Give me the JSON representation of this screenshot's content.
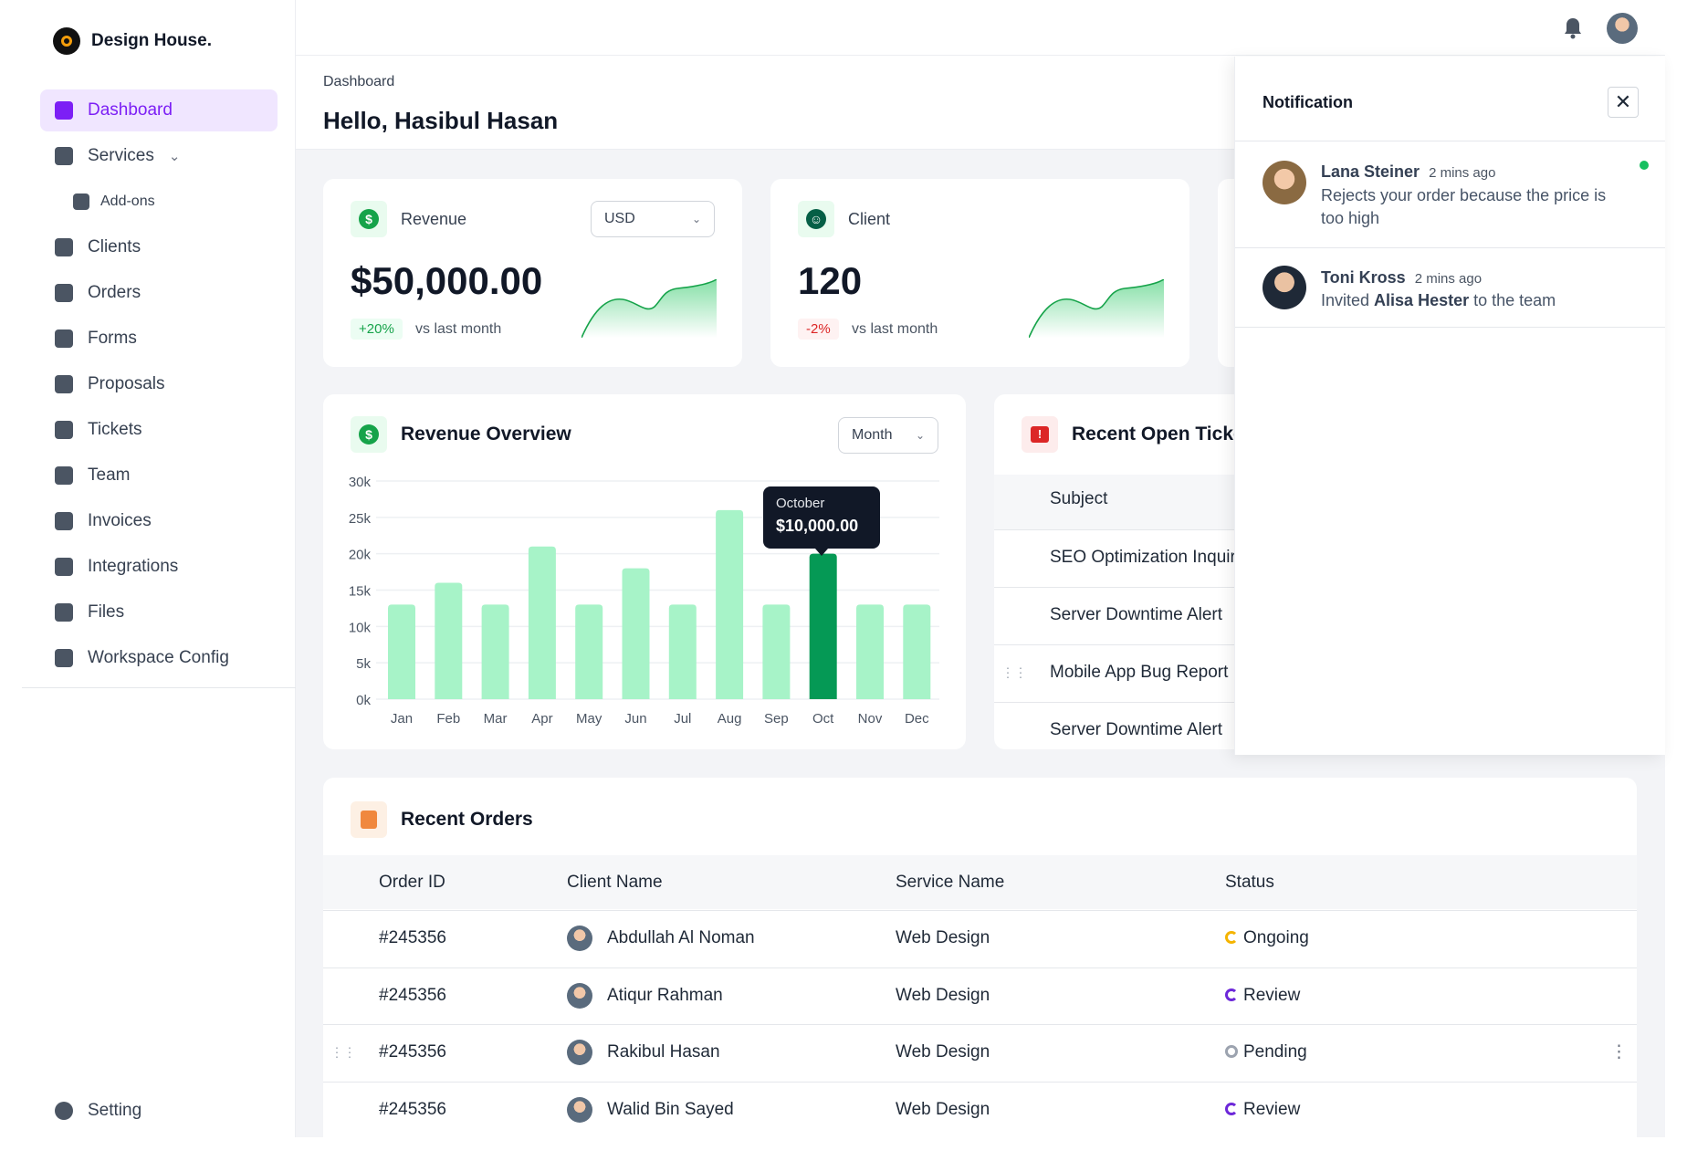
{
  "brand": {
    "name": "Design House."
  },
  "sidebar": {
    "items": [
      {
        "label": "Dashboard",
        "icon": "dashboard-icon",
        "active": true
      },
      {
        "label": "Services",
        "icon": "box-icon",
        "has_chevron": true
      },
      {
        "label": "Add-ons",
        "icon": "add-square-icon",
        "sub": true
      },
      {
        "label": "Clients",
        "icon": "users-icon"
      },
      {
        "label": "Orders",
        "icon": "list-icon"
      },
      {
        "label": "Forms",
        "icon": "file-icon"
      },
      {
        "label": "Proposals",
        "icon": "dollar-file-icon"
      },
      {
        "label": "Tickets",
        "icon": "alert-message-icon"
      },
      {
        "label": "Team",
        "icon": "id-card-icon"
      },
      {
        "label": "Invoices",
        "icon": "card-icon"
      },
      {
        "label": "Integrations",
        "icon": "code-box-icon"
      },
      {
        "label": "Files",
        "icon": "folder-icon"
      },
      {
        "label": "Workspace Config",
        "icon": "gears-icon"
      }
    ],
    "setting": "Setting"
  },
  "header": {
    "breadcrumb": "Dashboard",
    "title": "Hello, Hasibul Hasan"
  },
  "stats": [
    {
      "label": "Revenue",
      "value": "$50,000.00",
      "change": "+20%",
      "change_note": "vs last month",
      "currency": "USD",
      "trend": "up"
    },
    {
      "label": "Client",
      "value": "120",
      "change": "-2%",
      "change_note": "vs last month",
      "trend": "down"
    }
  ],
  "overview": {
    "title": "Revenue Overview",
    "period": "Month",
    "tooltip": {
      "label": "October",
      "value": "$10,000.00"
    }
  },
  "chart_data": {
    "type": "bar",
    "categories": [
      "Jan",
      "Feb",
      "Mar",
      "Apr",
      "May",
      "Jun",
      "Jul",
      "Aug",
      "Sep",
      "Oct",
      "Nov",
      "Dec"
    ],
    "values": [
      13000,
      16000,
      13000,
      21000,
      13000,
      18000,
      13000,
      26000,
      13000,
      20000,
      13000,
      13000
    ],
    "yticks": [
      "0k",
      "5k",
      "10k",
      "15k",
      "20k",
      "25k",
      "30k"
    ],
    "ylim": [
      0,
      30000
    ],
    "highlight": "Oct",
    "grid": true,
    "colors": {
      "bar": "#a7f3c8",
      "highlight": "#059955"
    }
  },
  "tickets": {
    "title": "Recent Open Tickets",
    "header": "Subject",
    "rows": [
      "SEO Optimization Inquiry",
      "Server Downtime Alert",
      "Mobile App Bug Report",
      "Server Downtime Alert"
    ]
  },
  "orders": {
    "title": "Recent Orders",
    "columns": [
      "Order ID",
      "Client Name",
      "Service Name",
      "Status"
    ],
    "rows": [
      {
        "id": "#245356",
        "client": "Abdullah Al Noman",
        "service": "Web Design",
        "status": "Ongoing",
        "status_color": "#f5b400"
      },
      {
        "id": "#245356",
        "client": "Atiqur Rahman",
        "service": "Web Design",
        "status": "Review",
        "status_color": "#6d28d9"
      },
      {
        "id": "#245356",
        "client": "Rakibul Hasan",
        "service": "Web Design",
        "status": "Pending",
        "status_color": "#9ca3af"
      },
      {
        "id": "#245356",
        "client": "Walid Bin Sayed",
        "service": "Web Design",
        "status": "Review",
        "status_color": "#6d28d9"
      }
    ]
  },
  "notifications": {
    "title": "Notification",
    "items": [
      {
        "name": "Lana Steiner",
        "time": "2 mins ago",
        "text": "Rejects your order because the price is too high",
        "unread": true
      },
      {
        "name": "Toni Kross",
        "time": "2 mins ago",
        "text_pre": "Invited ",
        "text_strong": "Alisa Hester",
        "text_post": " to the team"
      }
    ]
  }
}
